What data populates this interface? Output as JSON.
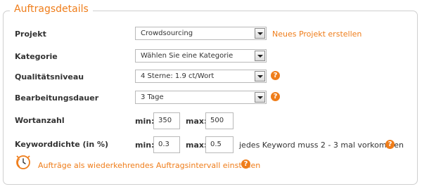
{
  "panel": {
    "title": "Auftragsdetails"
  },
  "rows": {
    "projekt": {
      "label": "Projekt",
      "value": "Crowdsourcing",
      "link": "Neues Projekt erstellen"
    },
    "kategorie": {
      "label": "Kategorie",
      "value": "Wählen Sie eine Kategorie"
    },
    "qualitaet": {
      "label": "Qualitätsniveau",
      "value": "4 Sterne: 1.9 ct/Wort"
    },
    "dauer": {
      "label": "Bearbeitungsdauer",
      "value": "3 Tage"
    },
    "wortanzahl": {
      "label": "Wortanzahl",
      "min_label": "min:",
      "min_value": "350",
      "max_label": "max:",
      "max_value": "500"
    },
    "keyword": {
      "label": "Keyworddichte (in %)",
      "min_label": "min:",
      "min_value": "0.3",
      "max_label": "max:",
      "max_value": "0.5",
      "note": "jedes Keyword muss 2 - 3 mal vorkommen"
    }
  },
  "recurring": {
    "link": "Aufträge als wiederkehrendes Auftragsintervall einstellen"
  },
  "help_symbol": "?",
  "colors": {
    "accent": "#ef7d1a",
    "border": "#cfcfcf"
  },
  "icons": {
    "help": "help-icon",
    "clock": "clock-icon",
    "dropdown": "chevron-down-icon"
  }
}
